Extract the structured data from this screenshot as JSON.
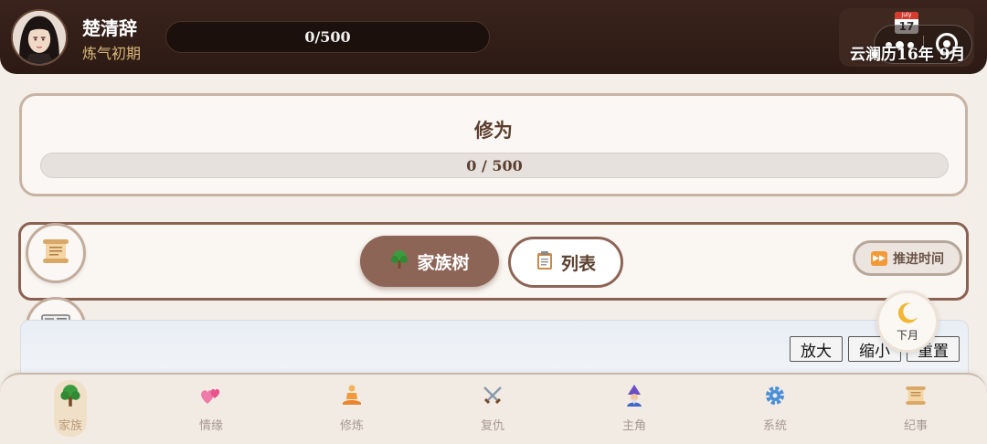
{
  "header": {
    "player_name": "楚清辞",
    "realm": "炼气初期",
    "progress_text": "0/500",
    "calendar_icon_month": "July",
    "calendar_icon_day": "17",
    "calendar_text_era": "云澜历",
    "calendar_text_date": "16年 9月"
  },
  "cultivation": {
    "title": "修为",
    "progress_text": "0 / 500",
    "progress_fraction": 0
  },
  "tabs": {
    "family_tree_icon": "tree-icon",
    "family_tree_label": "家族树",
    "list_icon": "clipboard-icon",
    "list_label": "列表",
    "advance_label": "推进时间"
  },
  "floating": {
    "next_month_label": "下月"
  },
  "tree_controls": {
    "zoom_in": "放大",
    "zoom_out": "缩小",
    "reset": "重置"
  },
  "nav": {
    "items": [
      {
        "label": "家族",
        "icon": "tree-icon",
        "active": true
      },
      {
        "label": "情缘",
        "icon": "hearts-icon"
      },
      {
        "label": "修炼",
        "icon": "meditation-icon"
      },
      {
        "label": "复仇",
        "icon": "crossed-swords-icon"
      },
      {
        "label": "主角",
        "icon": "mage-icon"
      },
      {
        "label": "系统",
        "icon": "gear-icon"
      },
      {
        "label": "纪事",
        "icon": "scroll-icon"
      }
    ]
  },
  "colors": {
    "header_bg": "#2c1a14",
    "accent_brown": "#8d6557",
    "realm_gold": "#d9b77a",
    "page_bg": "#f4eee8"
  }
}
